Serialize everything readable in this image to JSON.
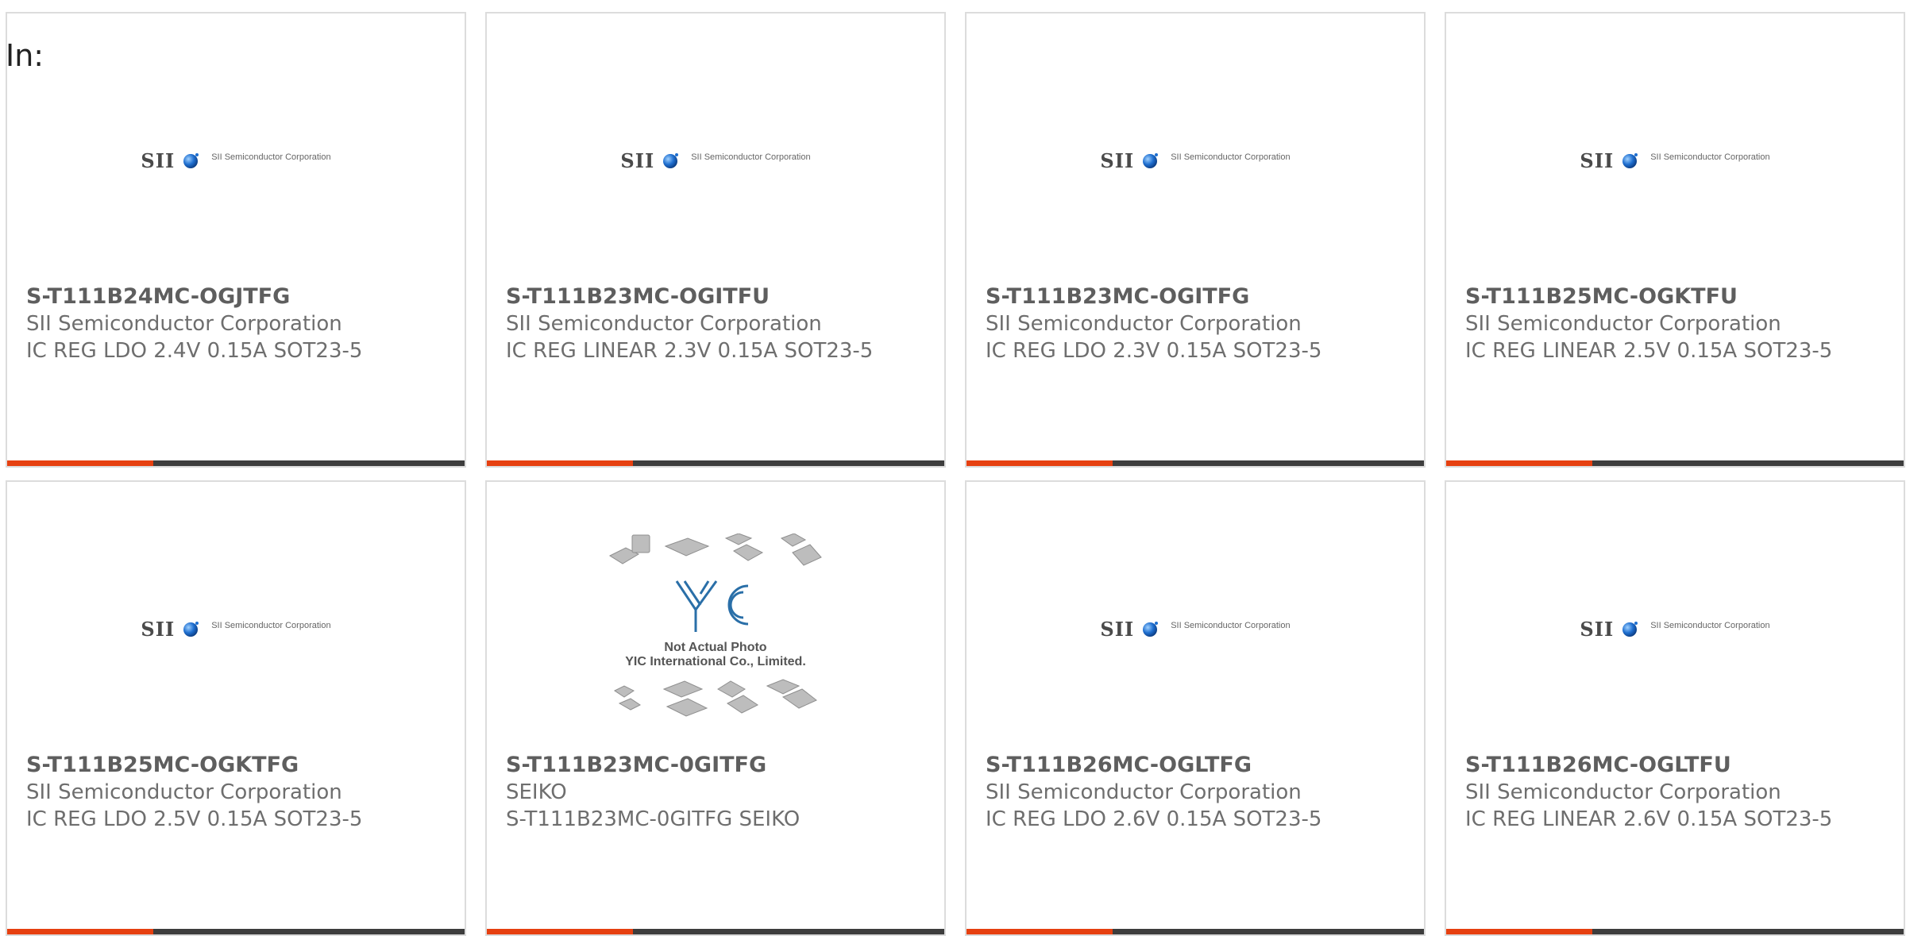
{
  "filter_label": "In:",
  "logo": {
    "mark": "SII",
    "company": "SII Semiconductor Corporation"
  },
  "placeholder": {
    "line1": "Not Actual Photo",
    "line2": "YIC International Co., Limited."
  },
  "colors": {
    "accent": "#e64010",
    "stripe": "#3d3d3d",
    "border": "#dcdcdc",
    "text": "#6e6e6e"
  },
  "products": [
    {
      "part_number": "S-T111B24MC-OGJTFG",
      "manufacturer": "SII Semiconductor Corporation",
      "description": "IC REG LDO 2.4V 0.15A SOT23-5",
      "image": "sii-logo"
    },
    {
      "part_number": "S-T111B23MC-OGITFU",
      "manufacturer": "SII Semiconductor Corporation",
      "description": "IC REG LINEAR 2.3V 0.15A SOT23-5",
      "image": "sii-logo"
    },
    {
      "part_number": "S-T111B23MC-OGITFG",
      "manufacturer": "SII Semiconductor Corporation",
      "description": "IC REG LDO 2.3V 0.15A SOT23-5",
      "image": "sii-logo"
    },
    {
      "part_number": "S-T111B25MC-OGKTFU",
      "manufacturer": "SII Semiconductor Corporation",
      "description": "IC REG LINEAR 2.5V 0.15A SOT23-5",
      "image": "sii-logo"
    },
    {
      "part_number": "S-T111B25MC-OGKTFG",
      "manufacturer": "SII Semiconductor Corporation",
      "description": "IC REG LDO 2.5V 0.15A SOT23-5",
      "image": "sii-logo"
    },
    {
      "part_number": "S-T111B23MC-0GITFG",
      "manufacturer": "SEIKO",
      "description": "S-T111B23MC-0GITFG SEIKO",
      "image": "placeholder"
    },
    {
      "part_number": "S-T111B26MC-OGLTFG",
      "manufacturer": "SII Semiconductor Corporation",
      "description": "IC REG LDO 2.6V 0.15A SOT23-5",
      "image": "sii-logo"
    },
    {
      "part_number": "S-T111B26MC-OGLTFU",
      "manufacturer": "SII Semiconductor Corporation",
      "description": "IC REG LINEAR 2.6V 0.15A SOT23-5",
      "image": "sii-logo"
    }
  ]
}
